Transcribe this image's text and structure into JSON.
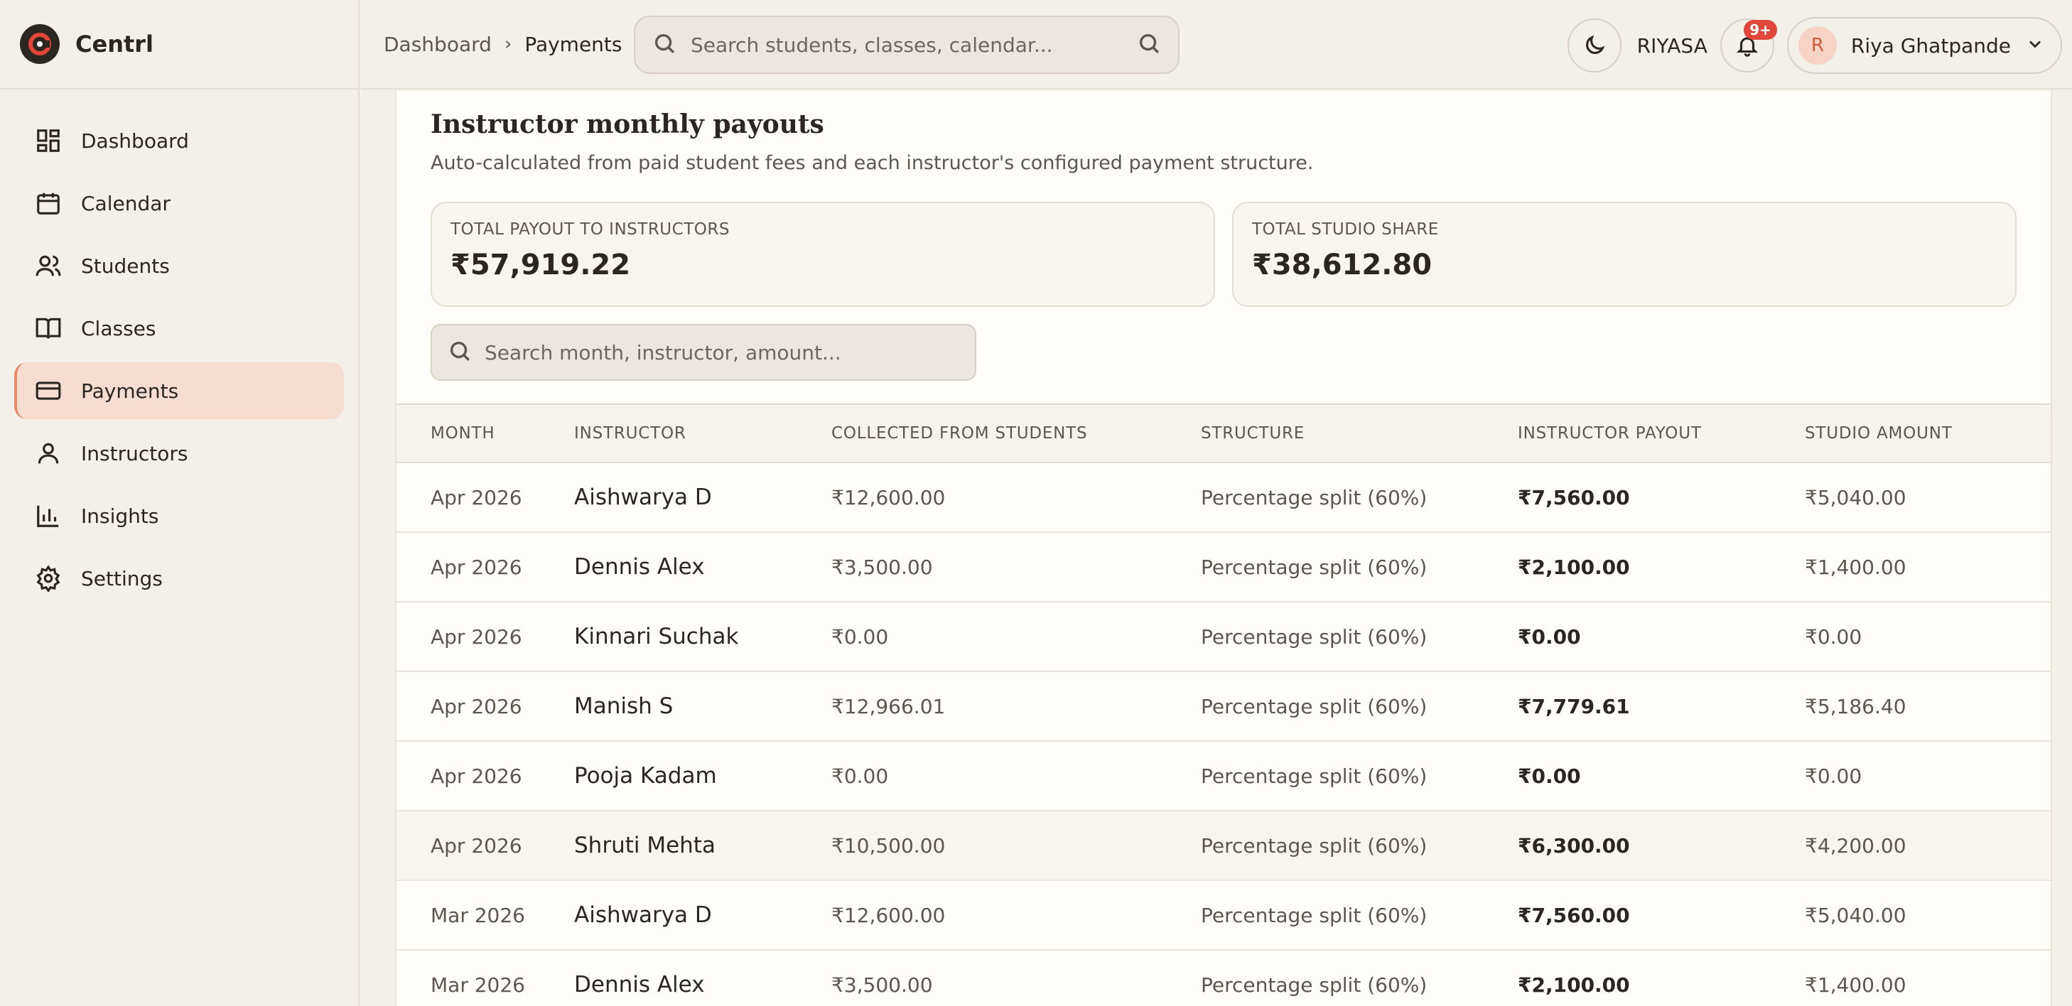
{
  "brand": {
    "name": "Centrl"
  },
  "sidebar": {
    "items": [
      {
        "label": "Dashboard",
        "icon": "dashboard-icon"
      },
      {
        "label": "Calendar",
        "icon": "calendar-icon"
      },
      {
        "label": "Students",
        "icon": "users-icon"
      },
      {
        "label": "Classes",
        "icon": "book-icon"
      },
      {
        "label": "Payments",
        "icon": "credit-card-icon",
        "active": true
      },
      {
        "label": "Instructors",
        "icon": "user-icon"
      },
      {
        "label": "Insights",
        "icon": "bar-chart-icon"
      },
      {
        "label": "Settings",
        "icon": "gear-icon"
      }
    ]
  },
  "header": {
    "breadcrumb": [
      "Dashboard",
      "Payments"
    ],
    "search_placeholder": "Search students, classes, calendar...",
    "org_name": "RIYASA",
    "notifications_badge": "9+",
    "user": {
      "initial": "R",
      "name": "Riya Ghatpande"
    }
  },
  "main": {
    "title": "Instructor monthly payouts",
    "subtitle": "Auto-calculated from paid student fees and each instructor's configured payment structure.",
    "stats": [
      {
        "label": "TOTAL PAYOUT TO INSTRUCTORS",
        "value": "₹57,919.22"
      },
      {
        "label": "TOTAL STUDIO SHARE",
        "value": "₹38,612.80"
      }
    ],
    "search_placeholder": "Search month, instructor, amount...",
    "table": {
      "columns": [
        "MONTH",
        "INSTRUCTOR",
        "COLLECTED FROM STUDENTS",
        "STRUCTURE",
        "INSTRUCTOR PAYOUT",
        "STUDIO AMOUNT"
      ],
      "rows": [
        [
          "Apr 2026",
          "Aishwarya D",
          "₹12,600.00",
          "Percentage split (60%)",
          "₹7,560.00",
          "₹5,040.00"
        ],
        [
          "Apr 2026",
          "Dennis Alex",
          "₹3,500.00",
          "Percentage split (60%)",
          "₹2,100.00",
          "₹1,400.00"
        ],
        [
          "Apr 2026",
          "Kinnari Suchak",
          "₹0.00",
          "Percentage split (60%)",
          "₹0.00",
          "₹0.00"
        ],
        [
          "Apr 2026",
          "Manish S",
          "₹12,966.01",
          "Percentage split (60%)",
          "₹7,779.61",
          "₹5,186.40"
        ],
        [
          "Apr 2026",
          "Pooja Kadam",
          "₹0.00",
          "Percentage split (60%)",
          "₹0.00",
          "₹0.00"
        ],
        [
          "Apr 2026",
          "Shruti Mehta",
          "₹10,500.00",
          "Percentage split (60%)",
          "₹6,300.00",
          "₹4,200.00"
        ],
        [
          "Mar 2026",
          "Aishwarya D",
          "₹12,600.00",
          "Percentage split (60%)",
          "₹7,560.00",
          "₹5,040.00"
        ],
        [
          "Mar 2026",
          "Dennis Alex",
          "₹3,500.00",
          "Percentage split (60%)",
          "₹2,100.00",
          "₹1,400.00"
        ]
      ]
    }
  },
  "colors": {
    "accent": "#e9896c",
    "active_bg": "#f7dcd0",
    "badge": "#e2453a"
  }
}
